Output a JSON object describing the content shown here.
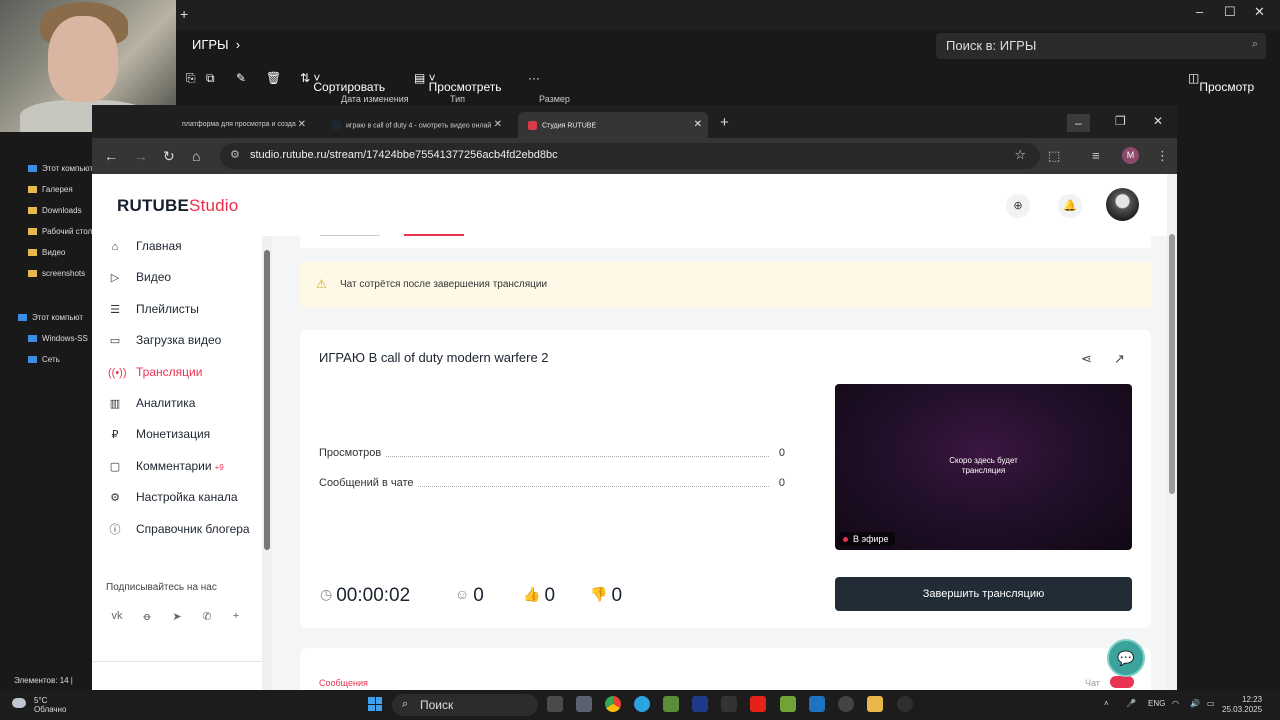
{
  "explorer": {
    "breadcrumb": "ИГРЫ",
    "search_placeholder": "Поиск в: ИГРЫ",
    "toolbar": {
      "sort": "Сортировать",
      "view": "Просмотреть",
      "preview": "Просмотр"
    },
    "columns": [
      "Дата изменения",
      "Тип",
      "Размер"
    ],
    "nav_items": [
      "Этот компьют",
      "Галерея",
      "Downloads",
      "Рабочий стол",
      "Видео",
      "screenshots",
      "Этот компьют",
      "Windows-SS",
      "Сеть"
    ],
    "status": "Элементов: 14 |"
  },
  "browser": {
    "tabs": [
      {
        "label": "платформа для просмотра и созда"
      },
      {
        "label": "играю в call of duty 4 - смотреть видео онлай"
      },
      {
        "label": "Студия RUTUBE"
      }
    ],
    "url": "studio.rutube.ru/stream/17424bbe75541377256acb4fd2ebd8bc",
    "profile_letter": "M"
  },
  "rutube": {
    "logo_main": "RUTUBE",
    "logo_sub": "Studio",
    "nav": [
      {
        "label": "Главная",
        "icon": "home-icon"
      },
      {
        "label": "Видео",
        "icon": "video-icon"
      },
      {
        "label": "Плейлисты",
        "icon": "playlist-icon"
      },
      {
        "label": "Загрузка видео",
        "icon": "upload-icon"
      },
      {
        "label": "Трансляции",
        "icon": "broadcast-icon"
      },
      {
        "label": "Аналитика",
        "icon": "analytics-icon"
      },
      {
        "label": "Монетизация",
        "icon": "money-icon"
      },
      {
        "label": "Комментарии",
        "icon": "comments-icon",
        "badge": "+9"
      },
      {
        "label": "Настройка канала",
        "icon": "settings-icon"
      },
      {
        "label": "Справочник блогера",
        "icon": "book-icon"
      }
    ],
    "subscribe_label": "Подписывайтесь на нас",
    "warning": "Чат сотрётся после завершения трансляции",
    "stream": {
      "title": "ИГРАЮ В call of duty modern warfere 2",
      "stats": [
        {
          "label": "Просмотров",
          "value": "0"
        },
        {
          "label": "Сообщений в чате",
          "value": "0"
        }
      ],
      "preview_text_line1": "Скоро здесь будет",
      "preview_text_line2": "трансляция",
      "live_label": "В эфире",
      "end_button": "Завершить трансляцию",
      "duration": "00:00:02",
      "viewers": "0",
      "likes": "0",
      "dislikes": "0"
    },
    "bottom_card": {
      "label": "Сообщения",
      "chat_label": "Чат"
    }
  },
  "taskbar": {
    "weather_temp": "5°C",
    "weather_desc": "Облачно",
    "search_label": "Поиск",
    "lang": "ENG",
    "time": "12:23",
    "date": "25.03.2025"
  }
}
